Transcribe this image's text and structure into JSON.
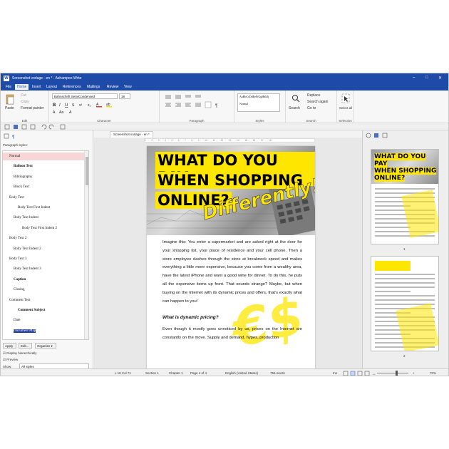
{
  "window": {
    "title": "Screenshot vorlage - en * - Ashampoo Write",
    "app_icon_letter": "W",
    "controls": [
      "–",
      "□",
      "✕"
    ]
  },
  "menu": [
    "File",
    "Home",
    "Insert",
    "Layout",
    "References",
    "Mailings",
    "Review",
    "View"
  ],
  "menu_active": "Home",
  "ribbon": {
    "edit": {
      "paste": "Paste",
      "cut": "Cut",
      "copy": "Copy",
      "format_painter": "Format painter",
      "label": "Edit"
    },
    "character": {
      "font": "Bahnschrift SemiCondensed",
      "size": "18",
      "label": "Character"
    },
    "paragraph": {
      "label": "Paragraph"
    },
    "styles": {
      "preview": "AaBbCcDdEeFfGgHhIiJj",
      "current": "Normal",
      "label": "Styles"
    },
    "search": {
      "search": "Search",
      "replace": "Replace",
      "search_again": "Search again",
      "go_to": "Go to",
      "label": "Search"
    },
    "selection": {
      "select_all": "Select all",
      "label": "Selection"
    }
  },
  "sidebar": {
    "title": "Paragraph styles:",
    "styles": [
      {
        "name": "Normal",
        "indent": 1,
        "selected": true
      },
      {
        "name": "Balloon Text",
        "indent": 2,
        "bold": true
      },
      {
        "name": "Bibliography",
        "indent": 2
      },
      {
        "name": "Block Text",
        "indent": 2
      },
      {
        "name": "Body Text",
        "indent": 1
      },
      {
        "name": "Body Text First Indent",
        "indent": 3
      },
      {
        "name": "Body Text Indent",
        "indent": 2
      },
      {
        "name": "Body Text First Indent 2",
        "indent": 4
      },
      {
        "name": "Body Text 2",
        "indent": 1
      },
      {
        "name": "Body Text Indent 2",
        "indent": 2
      },
      {
        "name": "Body Text 3",
        "indent": 1
      },
      {
        "name": "Body Text Indent 3",
        "indent": 2
      },
      {
        "name": "Caption",
        "indent": 2,
        "bold": true
      },
      {
        "name": "Closing",
        "indent": 2
      },
      {
        "name": "Comment Text",
        "indent": 1
      },
      {
        "name": "Comment Subject",
        "indent": 3,
        "bold": true
      },
      {
        "name": "Date",
        "indent": 2
      },
      {
        "name": "Document Map",
        "indent": 2,
        "highlight": true
      }
    ],
    "apply": "Apply",
    "edit": "Edit...",
    "organize": "Organize",
    "display_hierarchically": "Display hierarchically",
    "preview": "Preview",
    "show_label": "Show:",
    "show_value": "All styles"
  },
  "document": {
    "tab": "Screenshot vorlage - en *",
    "ruler": "1 · · · 2 · · · 3 · · · 4 · · · 5 · · · 6 · · · 7 · · · 8 · · · 9 · · · 10 · · · 11 · · · 12 · · · 13 · · · 14 · · · 15 · · · 16 · · · 17 · · · 18",
    "headline_1": "WHAT DO YOU PAY",
    "headline_2": "WHEN SHOPPING",
    "headline_3": "ONLINE?",
    "differently": "Differently!",
    "para1": "Imagine this: You enter a supermarket and are asked right at the door for your shopping list, your place of residence and your cell phone. Then a store employee dashes through the store at breakneck speed and makes everything a little more expensive, because you come from a wealthy area, have the latest iPhone and want a good wine for dinner. To do this, he puts all the expensive items up front. That sounds strange? Maybe, but when buying on the Internet with its dynamic prices and offers, that's exactly what can happen to you!",
    "subheading": "What is dynamic pricing?",
    "para2": "Even though it mostly goes unnoticed by us, prices on the Internet are constantly on the move. Supply and demand, hypes, production",
    "stamp": "€$"
  },
  "thumbnails": {
    "page1_num": "1",
    "page2_num": "2",
    "heading_1": "WHAT DO YOU PAY",
    "heading_2": "WHEN SHOPPING",
    "heading_3": "ONLINE?"
  },
  "status": {
    "position": "L 18 Col 71",
    "section": "Section 1",
    "chapter": "Chapter 1",
    "page": "Page 4 of 4",
    "language": "English (United States)",
    "words": "756 words",
    "mode": "Ins",
    "zoom": "70%"
  },
  "colors": {
    "title_blue": "#1e4aa8",
    "yellow": "#ffe600",
    "selected_style": "#f9d6d6"
  }
}
